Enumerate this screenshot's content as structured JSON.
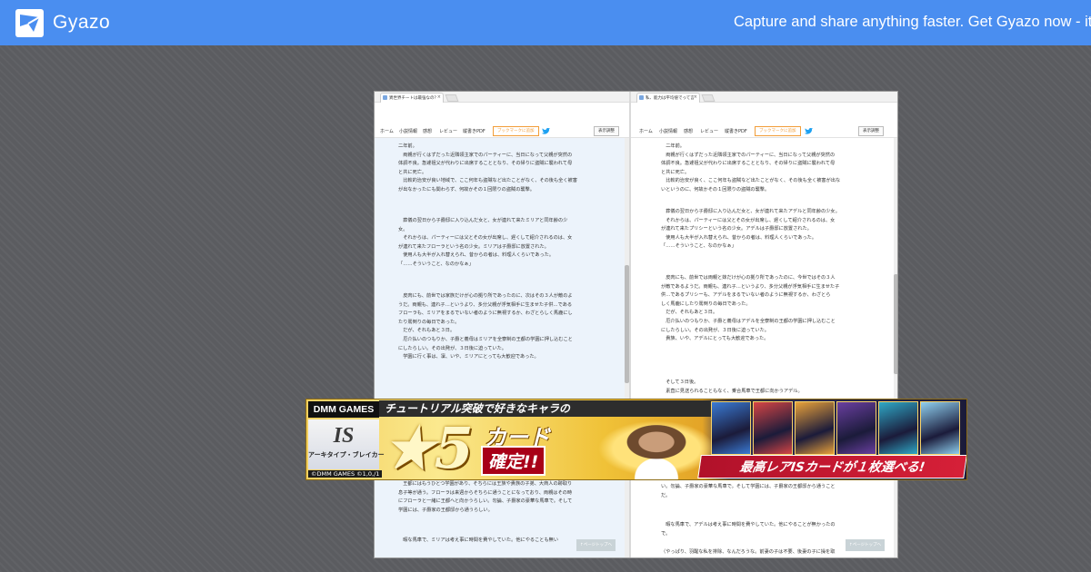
{
  "topbar": {
    "brand": "Gyazo",
    "promo": "Capture and share anything faster. Get Gyazo now - it's f",
    "bg_color": "#4a8ef0"
  },
  "screenshot": {
    "left": {
      "tab_title": "異世界チートは最強なの？",
      "nav": [
        "ホーム",
        "小説情報",
        "感想",
        "レビュー",
        "縦書きPDF"
      ],
      "bookmark_label": "ブックマークに追加",
      "display_label": "表示調整",
      "paragraphs": [
        "二年前。\n　両親が行くはずだった近隣領主家でのパーティーに、当日になって父親が突然の\n体調不良。急遽祖父が代わりに出席することとなり、その帰りに盗賊に襲われて母\nと共に死亡。\n　比較的治安が良い地域で、ここ何年も盗賊など出たことがなく、その後も全く被害\nが出なかったにも関わらず、何故かその１回限りの盗賊の襲撃。",
        "　葬儀の翌日から子爵邸に入り込んだ女と、女が連れて来たミリアと同年齢の少\n女。\n　それからは、パーティーには父とその女が出席し、遅くして紹介されるのは、女\nが連れて来たフローラという名の少女。ミリアは子爵邸に放置された。\n　使用人も大半が入れ替えられ、昔からの者は、料理人くらいであった。\n「……そういうこと、なのかなぁ」",
        "　皮肉にも、前世では家族だけが心の拠り所であったのに、次はその３人が敵のよ\nうだ。両親も、連れ子…というより、多分父親が浮気相手に生ませた子供…である\nフローラも、ミリアをまるでいない者のように無視するか、わざとらしく馬鹿にし\nたり罵倒りの毎日であった。\n　だが、それもあと３日。\n　厄介払いのつもりか、子爵と義母はミリアを全寮制の王都の学園に押し込むこと\nにしたらしい。その出発が、３日後に迫っていた。\n　学園に行く事は、凜、いや、ミリアにとっても大歓迎であった。",
        "　王都にはもうひとつ学園があり、そちらには王族や貴族の子弟、大商人の跡取り\n息子等が通う。フローラは来週からそちらに通うことになっており、両親はその時\nにフローラと一緒に王都へと向かうらしい。勿論、子爵家の豪華な馬車で。そして\n学園には、子爵家の王都邸から通うらしい。",
        "　暇な馬車で、ミリアは考え事に時間を費やしていた。他にやることも無い"
      ],
      "pagetop_label": "↑ページトップへ"
    },
    "right": {
      "tab_title": "私、能力は平均値でって言",
      "nav": [
        "ホーム",
        "小説情報",
        "感想",
        "レビュー",
        "縦書きPDF"
      ],
      "bookmark_label": "ブックマークに追加",
      "display_label": "表示調整",
      "paragraphs": [
        "　二年前。\n　両親が行くはずだった近隣領主家でのパーティーに、当日になって父親が突然の\n体調不良。急遽祖父が代わりに出席することとなり、その帰りに盗賊に襲われて母\nと共に死亡。\n　比較的治安が良く、ここ何年も盗賊など出たことがなく、その後も全く被害が出な\nいというのに、何故かその１回限りの盗賊の襲撃。",
        "　葬儀の翌日から子爵邸に入り込んだ女と、女が連れて来たアデルと同年齢の少女。\n　それからは、パーティーには父とその女が出席し、遅くして紹介されるのは、女\nが連れて来たプリシーという名の少女。アデルは子爵邸に放置された。\n　使用人も大半が入れ替えられ、昔からの者は、料理人くらいであった。\n「……そういうこと、なのかなぁ」",
        "　皮肉にも、前世では両親と妹だけが心の拠り所であったのに、今世ではその３人\nが敵であるようだ。両親も、連れ子…というより、多分父親が浮気相手に生ませた子\n供…であるプリシーも、アデルをまるでいない者のように無視するか、わざとら\nしく馬鹿にしたり罵倒りの毎日であった。\n　だが、それもあと３日。\n　厄介払いのつもりか、子爵と義母はアデルを全寮制の王都の学園に押し込むこと\nにしたらしい。その出発が、３日後に迫っていた。\n　貴族、いや、アデルにとっても大歓迎であった。",
        "　そして３日後。\n　素直に見送られることもなく、乗合馬車で王都に向かうアデル。",
        "い。勿論、子爵家の豪華な馬車で。そして学園には、子爵家の王都邸から通うこと\nだ。",
        "　暇な馬車で、アデルは考え事に時間を費やしていた。他にやることが無かったの\nで。",
        "（やっぱり、羽醒な私を排除、なんだろうな。前妻の子は不要、後妻の子に操を取"
      ],
      "pagetop_label": "↑ページトップへ"
    }
  },
  "banner": {
    "logo": "DMM GAMES",
    "game_mark": "IS",
    "game_title": "アーキタイプ・ブレイカー",
    "copyright": "©DMM GAMES ©1,0,/1",
    "headline": "チュートリアル突破で好きなキャラの",
    "star": "★5",
    "card_label": "カード",
    "confirm_label": "確定!!",
    "bottom_text": "最高レアISカードが１枚選べる!",
    "card_colors": [
      "#3a7bd5",
      "#d64545",
      "#e8a13a",
      "#6a3fa0",
      "#2fa9c7",
      "#8fd0f0"
    ]
  }
}
